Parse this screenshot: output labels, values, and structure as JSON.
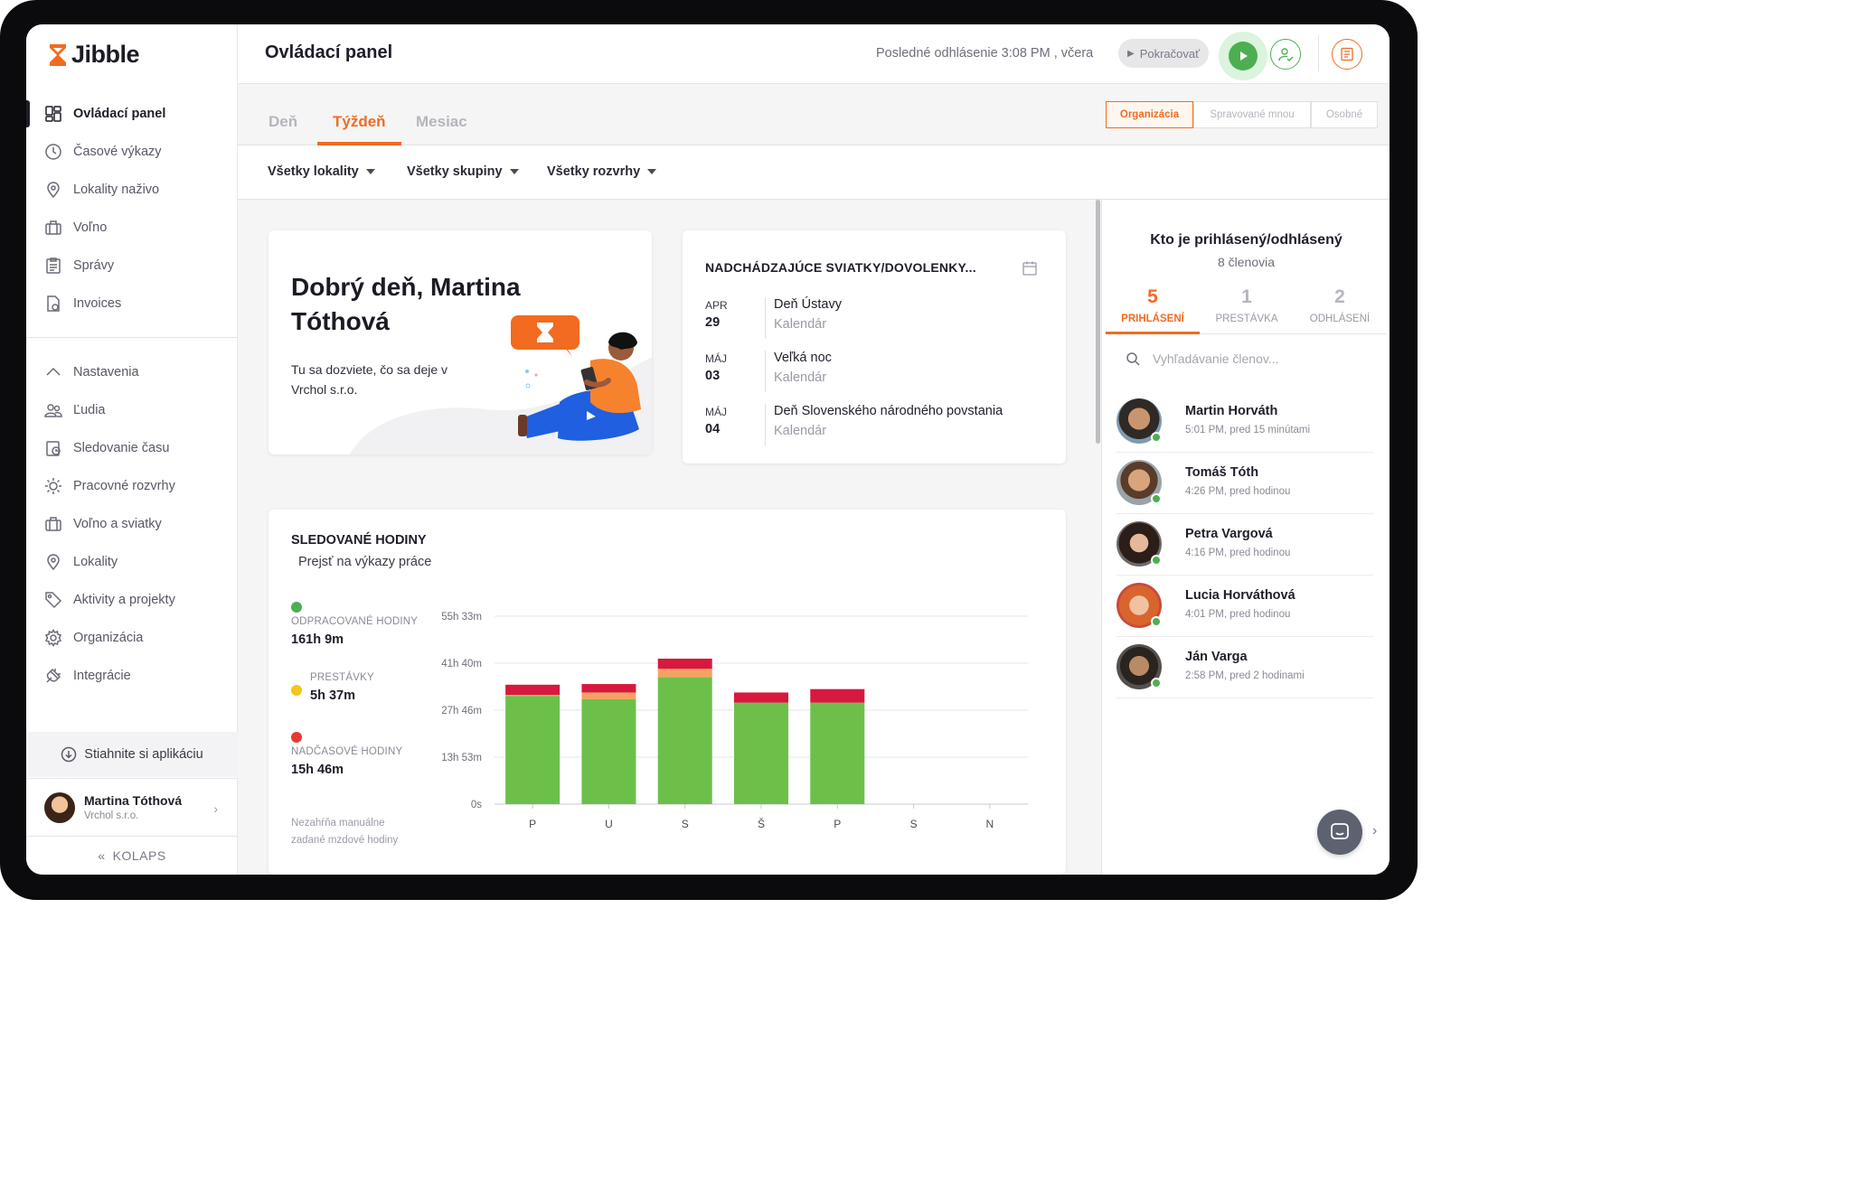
{
  "app": {
    "logo": "Jibble"
  },
  "sidebar": {
    "main": [
      {
        "label": "Ovládací panel",
        "icon": "dashboard-icon"
      },
      {
        "label": "Časové výkazy",
        "icon": "clock-icon"
      },
      {
        "label": "Lokality naživo",
        "icon": "location-pin-icon"
      },
      {
        "label": "Voľno",
        "icon": "suitcase-icon"
      },
      {
        "label": "Správy",
        "icon": "clipboard-icon"
      },
      {
        "label": "Invoices",
        "icon": "invoice-icon"
      }
    ],
    "settings": [
      {
        "label": "Nastavenia",
        "icon": "chevron-up-icon"
      },
      {
        "label": "Ľudia",
        "icon": "people-icon"
      },
      {
        "label": "Sledovanie času",
        "icon": "time-tracking-icon"
      },
      {
        "label": "Pracovné rozvrhy",
        "icon": "schedule-icon"
      },
      {
        "label": "Voľno a sviatky",
        "icon": "suitcase-icon"
      },
      {
        "label": "Lokality",
        "icon": "location-pin-icon"
      },
      {
        "label": "Aktivity a projekty",
        "icon": "tag-icon"
      },
      {
        "label": "Organizácia",
        "icon": "gear-icon"
      },
      {
        "label": "Integrácie",
        "icon": "plug-icon"
      }
    ],
    "download": "Stiahnite si aplikáciu",
    "user": {
      "name": "Martina Tóthová",
      "org": "Vrchol s.r.o."
    },
    "collapse": "KOLAPS"
  },
  "header": {
    "title": "Ovládací panel",
    "last_logout": "Posledné odhlásenie 3:08 PM , včera",
    "continue": "Pokračovať"
  },
  "tabs": {
    "items": [
      "Deň",
      "Týždeň",
      "Mesiac"
    ],
    "active": "Týždeň",
    "scope": [
      "Organizácia",
      "Spravované mnou",
      "Osobné"
    ],
    "scope_active": "Organizácia"
  },
  "filters": [
    "Všetky lokality",
    "Všetky skupiny",
    "Všetky rozvrhy"
  ],
  "greeting": {
    "title": "Dobrý deň, Martina Tóthová",
    "subtitle": "Tu sa dozviete, čo sa deje v Vrchol s.r.o."
  },
  "holidays": {
    "title": "NADCHÁDZAJÚCE SVIATKY/DOVOLENKY...",
    "items": [
      {
        "month": "APR",
        "day": "29",
        "name": "Deň Ústavy",
        "calendar": "Kalendár"
      },
      {
        "month": "MÁJ",
        "day": "03",
        "name": "Veľká noc",
        "calendar": "Kalendár"
      },
      {
        "month": "MÁJ",
        "day": "04",
        "name": "Deň Slovenského národného povstania",
        "calendar": "Kalendár"
      }
    ]
  },
  "tracked": {
    "title": "SLEDOVANÉ HODINY",
    "link": "Prejsť na výkazy práce",
    "stats": [
      {
        "label": "ODPRACOVANÉ HODINY",
        "value": "161h 9m",
        "color": "#4caf50"
      },
      {
        "label": "PRESTÁVKY",
        "value": "5h 37m",
        "color": "#f5c518"
      },
      {
        "label": "NADČASOVÉ HODINY",
        "value": "15h 46m",
        "color": "#e53935"
      }
    ],
    "note": "Nezahŕňa manuálne zadané mzdové hodiny"
  },
  "chart_data": {
    "type": "bar",
    "stacked": true,
    "categories": [
      "P",
      "U",
      "S",
      "Š",
      "P",
      "S",
      "N"
    ],
    "y_ticks": [
      "0s",
      "13h 53m",
      "27h 46m",
      "41h 40m",
      "55h 33m"
    ],
    "ylim": [
      0,
      55.55
    ],
    "colors": {
      "worked": "#6cc04a",
      "breaks": "#f4a261",
      "overtime": "#d7193f"
    },
    "series": [
      {
        "name": "ODPRACOVANÉ HODINY",
        "values": [
          32.0,
          31.0,
          37.5,
          30.0,
          30.0,
          0,
          0
        ]
      },
      {
        "name": "PRESTÁVKY",
        "values": [
          0.3,
          2.0,
          2.5,
          0,
          0,
          0,
          0
        ]
      },
      {
        "name": "NADČASOVÉ HODINY",
        "values": [
          3.0,
          2.5,
          3.0,
          3.0,
          4.0,
          0,
          0
        ]
      }
    ],
    "grid": true
  },
  "who": {
    "title": "Kto je prihlásený/odhlásený",
    "count": "8 členovia",
    "tabs": [
      {
        "num": "5",
        "label": "PRIHLÁSENÍ"
      },
      {
        "num": "1",
        "label": "PRESTÁVKA"
      },
      {
        "num": "2",
        "label": "ODHLÁSENÍ"
      }
    ],
    "search_placeholder": "Vyhľadávanie členov...",
    "members": [
      {
        "name": "Martin Horváth",
        "time": "5:01 PM, pred 15 minútami"
      },
      {
        "name": "Tomáš Tóth",
        "time": "4:26 PM, pred hodinou"
      },
      {
        "name": "Petra Vargová",
        "time": "4:16 PM, pred hodinou"
      },
      {
        "name": "Lucia Horváthová",
        "time": "4:01 PM, pred hodinou"
      },
      {
        "name": "Ján Varga",
        "time": "2:58 PM, pred 2 hodinami"
      }
    ]
  }
}
